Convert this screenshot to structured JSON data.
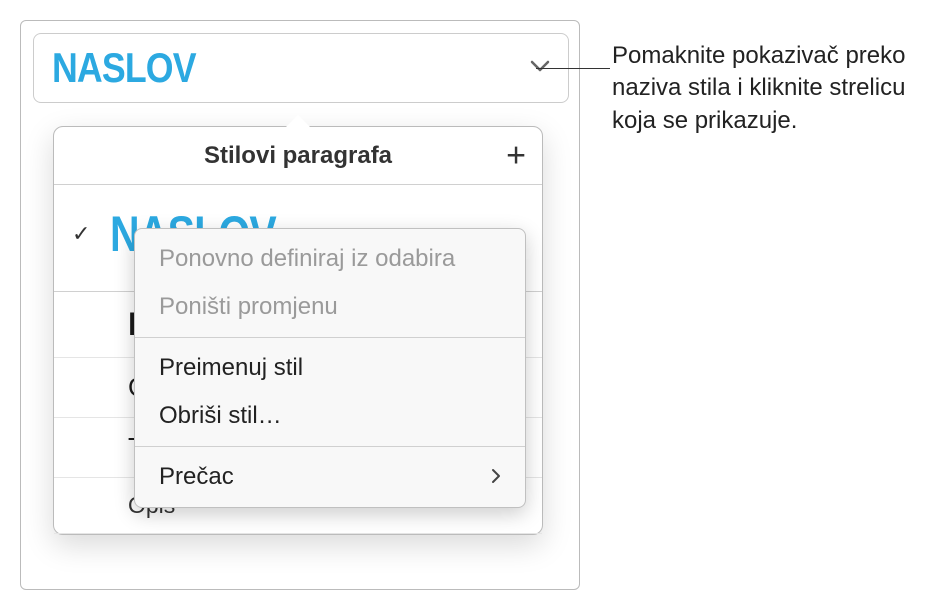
{
  "style_picker": {
    "current_style": "NASLOV"
  },
  "popover": {
    "header_title": "Stilovi paragrafa",
    "styles": {
      "naslov": "NASLOV",
      "po": "Po",
      "glav": "Glav",
      "tije": "Tije",
      "opis": "Opis"
    }
  },
  "context_menu": {
    "redefine": "Ponovno definiraj iz odabira",
    "undo": "Poništi promjenu",
    "rename": "Preimenuj stil",
    "delete": "Obriši stil…",
    "shortcut": "Prečac"
  },
  "callout": {
    "text": "Pomaknite pokazivač preko naziva stila i kliknite strelicu koja se prikazuje."
  }
}
